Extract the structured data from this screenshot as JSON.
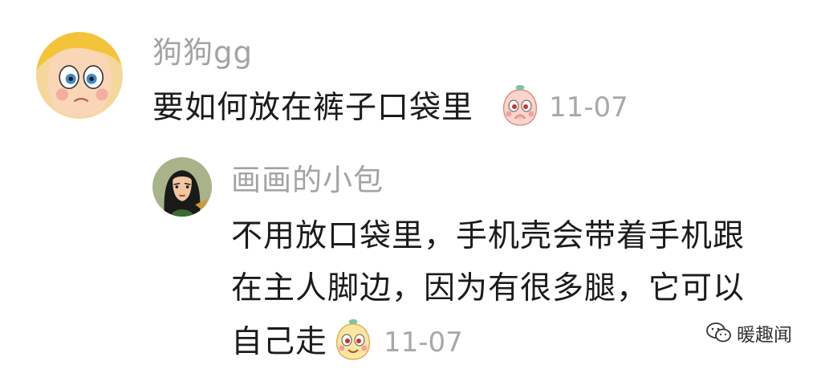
{
  "comment": {
    "username": "狗狗gg",
    "text": "要如何放在裤子口袋里",
    "emoji": "shy-peach-emoji",
    "timestamp": "11-07"
  },
  "reply": {
    "username": "画画的小包",
    "lines": [
      "不用放口袋里，手机壳会带着手机跟",
      "在主人脚边，因为有很多腿，它可以",
      "自己走"
    ],
    "emoji": "happy-peach-emoji",
    "timestamp": "11-07"
  },
  "watermark": {
    "label": "暖趣闻",
    "icon": "wechat-icon"
  }
}
